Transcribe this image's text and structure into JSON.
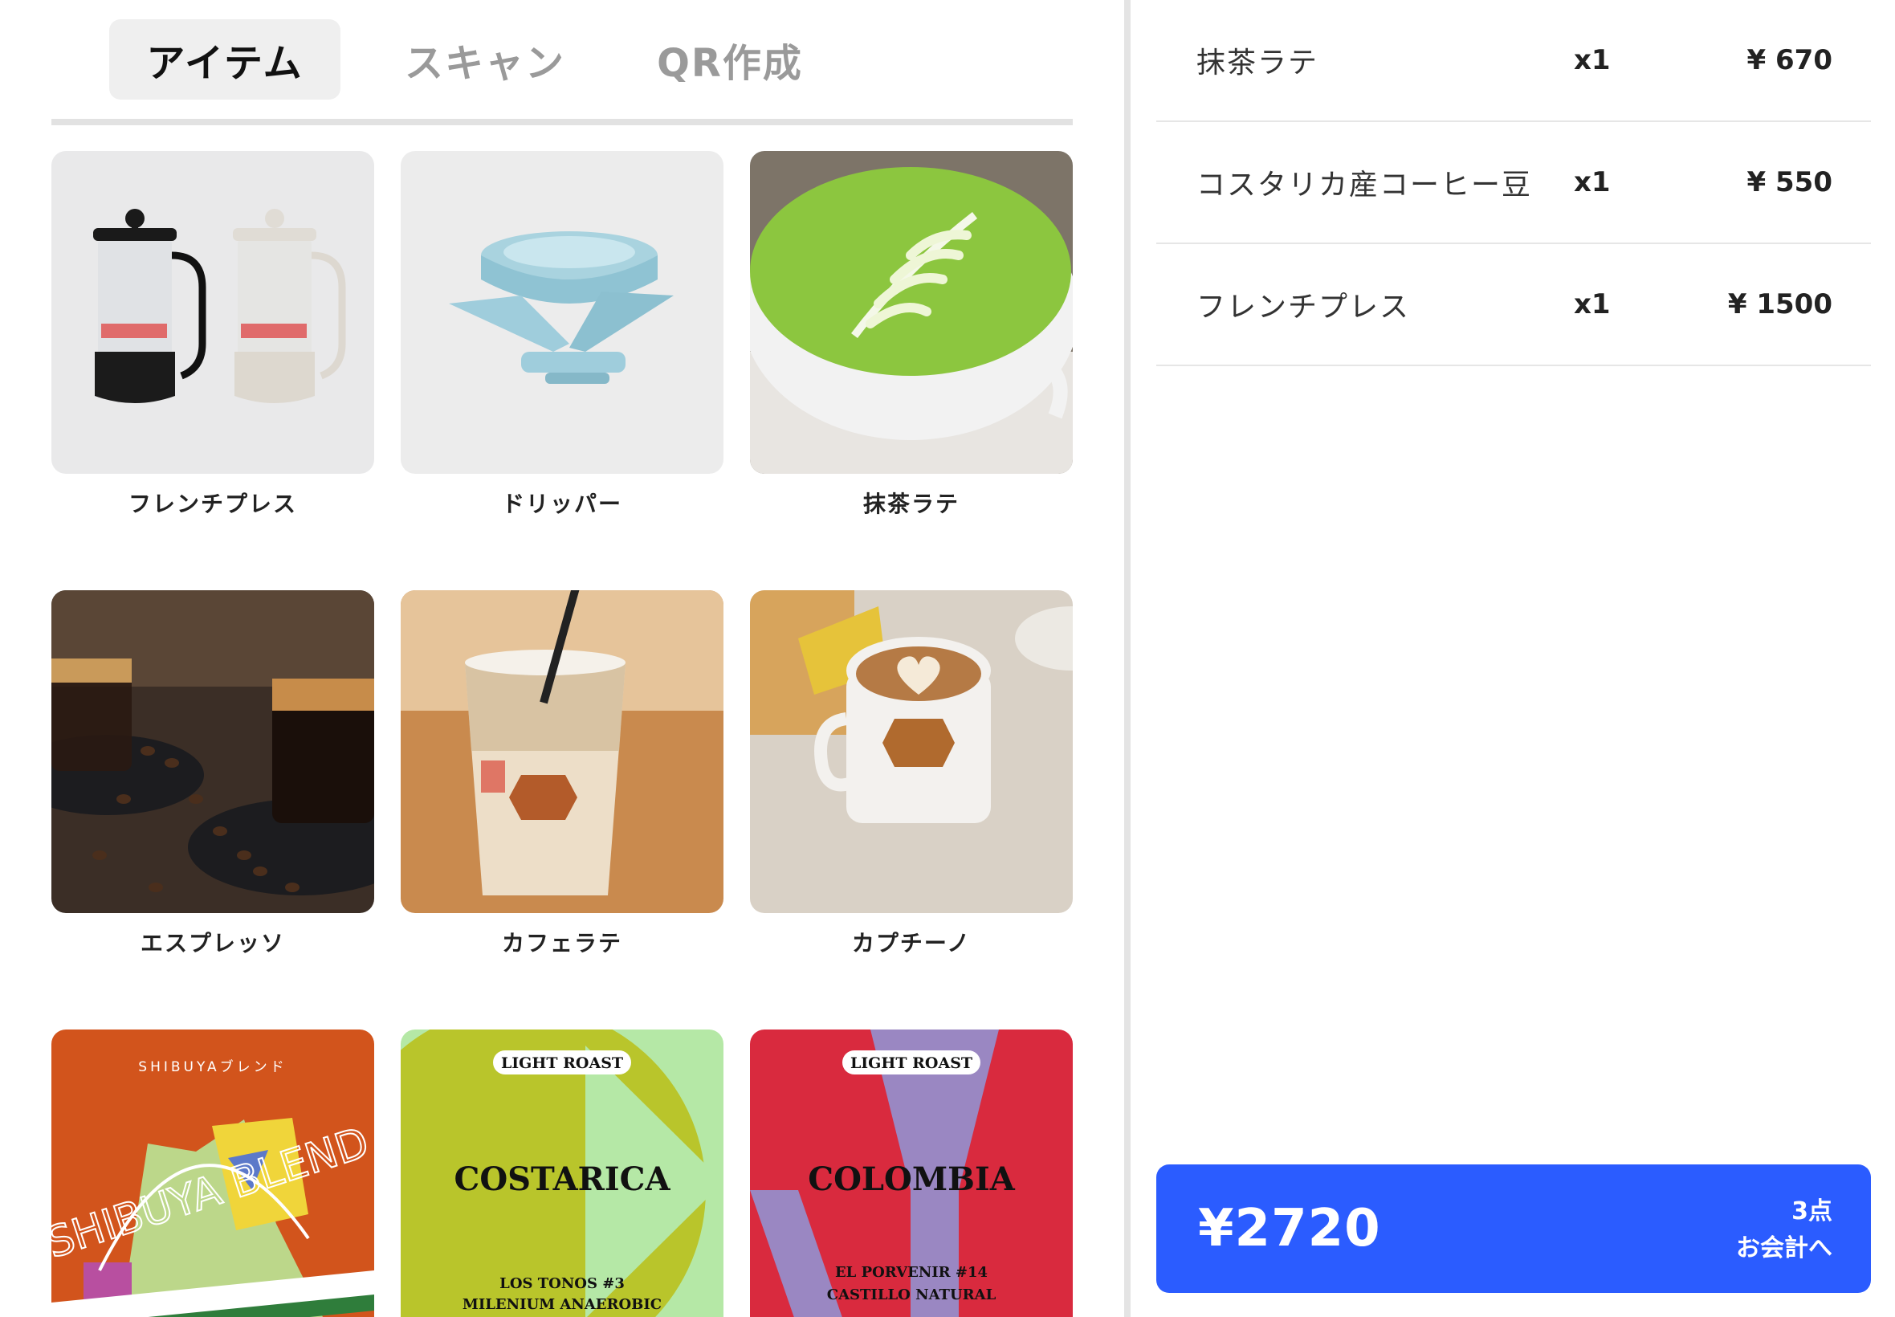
{
  "tabs": [
    {
      "label": "アイテム",
      "active": true
    },
    {
      "label": "スキャン",
      "active": false
    },
    {
      "label": "QR作成",
      "active": false
    }
  ],
  "products": [
    {
      "name": "フレンチプレス",
      "image": "french-press"
    },
    {
      "name": "ドリッパー",
      "image": "dripper"
    },
    {
      "name": "抹茶ラテ",
      "image": "matcha-latte"
    },
    {
      "name": "エスプレッソ",
      "image": "espresso"
    },
    {
      "name": "カフェラテ",
      "image": "iced-cafe-latte"
    },
    {
      "name": "カプチーノ",
      "image": "cappuccino"
    },
    {
      "name": "",
      "image": "shibuya-blend-package",
      "package_text": "SHIBUYAブレンド",
      "package_art": "SHIBUYA BLEND"
    },
    {
      "name": "",
      "image": "costarica-package",
      "badge": "LIGHT ROAST",
      "title": "COSTARICA",
      "sub1": "LOS TONOS #3",
      "sub2": "MILENIUM ANAEROBIC"
    },
    {
      "name": "",
      "image": "colombia-package",
      "badge": "LIGHT ROAST",
      "title": "COLOMBIA",
      "sub1": "EL PORVENIR #14",
      "sub2": "CASTILLO NATURAL"
    }
  ],
  "cart": {
    "items": [
      {
        "name": "抹茶ラテ",
        "qty": "x1",
        "price": "¥ 670"
      },
      {
        "name": "コスタリカ産コーヒー豆",
        "qty": "x1",
        "price": "¥ 550"
      },
      {
        "name": "フレンチプレス",
        "qty": "x1",
        "price": "¥ 1500"
      }
    ],
    "total": "¥2720",
    "count": "3点",
    "checkout_label": "お会計へ"
  },
  "colors": {
    "accent": "#2b5cff",
    "tab_active_bg": "#efefef",
    "tab_inactive_text": "#9a9a9a",
    "divider": "#e4e4e4"
  }
}
